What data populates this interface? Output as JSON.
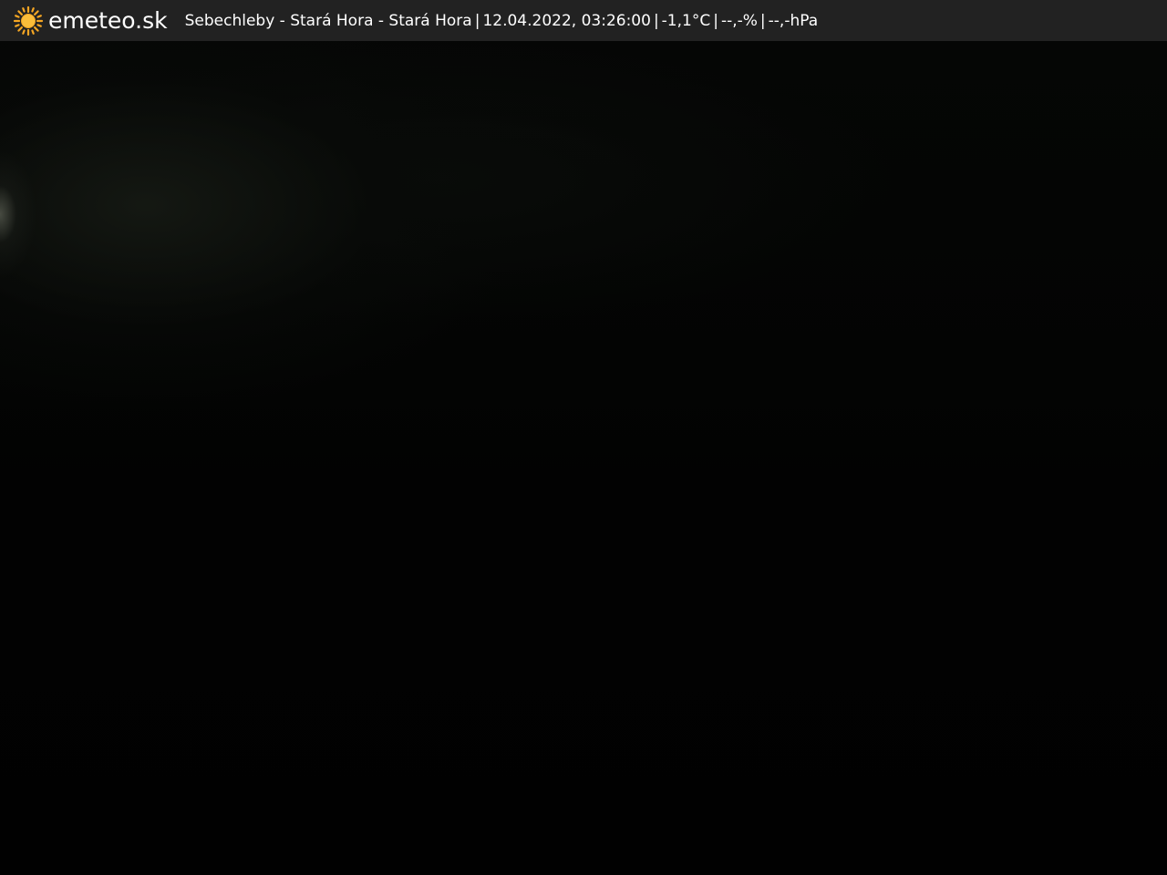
{
  "brand": {
    "name": "emeteo.sk",
    "icon": "sun-icon",
    "icon_color": "#f5a623"
  },
  "caption": {
    "location": "Sebechleby - Stará Hora - Stará Hora",
    "datetime": "12.04.2022, 03:26:00",
    "temperature": "-1,1°C",
    "humidity": "--,-%",
    "pressure": "--,-hPa",
    "separator": "|"
  },
  "colors": {
    "bar_background": "#222222",
    "text": "#ffffff",
    "scene": "#000000"
  }
}
